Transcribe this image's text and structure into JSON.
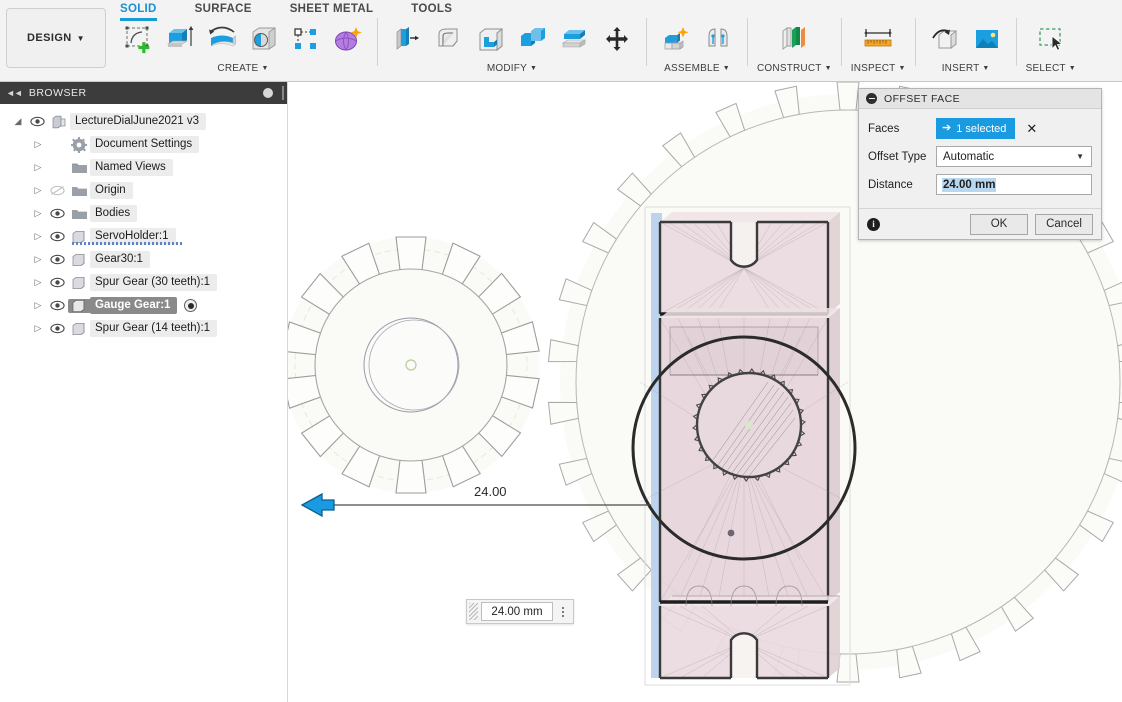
{
  "app": {
    "workspace_button": "DESIGN",
    "tabs": [
      {
        "label": "SOLID",
        "active": true
      },
      {
        "label": "SURFACE",
        "active": false
      },
      {
        "label": "SHEET METAL",
        "active": false
      },
      {
        "label": "TOOLS",
        "active": false
      }
    ],
    "groups": [
      {
        "name": "CREATE",
        "label": "CREATE",
        "icons": [
          "create-sketch-icon",
          "extrude-icon",
          "revolve-icon",
          "sweep-icon",
          "pattern-icon",
          "form-icon"
        ]
      },
      {
        "name": "MODIFY",
        "label": "MODIFY",
        "icons": [
          "press-pull-icon",
          "fillet-icon",
          "shell-icon",
          "combine-icon",
          "offset-face-icon",
          "move-copy-icon"
        ]
      },
      {
        "name": "ASSEMBLE",
        "label": "ASSEMBLE",
        "icons": [
          "new-component-icon",
          "joint-icon"
        ]
      },
      {
        "name": "CONSTRUCT",
        "label": "CONSTRUCT",
        "icons": [
          "offset-plane-icon"
        ]
      },
      {
        "name": "INSPECT",
        "label": "INSPECT",
        "icons": [
          "measure-icon"
        ]
      },
      {
        "name": "INSERT",
        "label": "INSERT",
        "icons": [
          "insert-derive-icon",
          "insert-canvas-icon"
        ]
      },
      {
        "name": "SELECT",
        "label": "SELECT",
        "icons": [
          "select-window-icon"
        ]
      }
    ]
  },
  "browser": {
    "title": "BROWSER",
    "items": [
      {
        "label": "LectureDialJune2021 v3",
        "depth": 0,
        "expanded": true,
        "eye": "visible",
        "icon": "document-icon",
        "selected": false,
        "radio": false,
        "dotted": false
      },
      {
        "label": "Document Settings",
        "depth": 1,
        "expanded": false,
        "eye": "none",
        "icon": "gear-icon",
        "selected": false,
        "radio": false,
        "dotted": false
      },
      {
        "label": "Named Views",
        "depth": 1,
        "expanded": false,
        "eye": "none",
        "icon": "folder-icon",
        "selected": false,
        "radio": false,
        "dotted": false
      },
      {
        "label": "Origin",
        "depth": 1,
        "expanded": false,
        "eye": "hidden",
        "icon": "folder-icon",
        "selected": false,
        "radio": false,
        "dotted": false
      },
      {
        "label": "Bodies",
        "depth": 1,
        "expanded": false,
        "eye": "visible",
        "icon": "folder-icon",
        "selected": false,
        "radio": false,
        "dotted": false
      },
      {
        "label": "ServoHolder:1",
        "depth": 1,
        "expanded": false,
        "eye": "visible",
        "icon": "component-icon",
        "selected": false,
        "radio": false,
        "dotted": true
      },
      {
        "label": "Gear30:1",
        "depth": 1,
        "expanded": false,
        "eye": "visible",
        "icon": "component-icon",
        "selected": false,
        "radio": false,
        "dotted": false
      },
      {
        "label": "Spur Gear (30 teeth):1",
        "depth": 1,
        "expanded": false,
        "eye": "visible",
        "icon": "component-icon",
        "selected": false,
        "radio": false,
        "dotted": false
      },
      {
        "label": "Gauge Gear:1",
        "depth": 1,
        "expanded": false,
        "eye": "visible",
        "icon": "component-icon",
        "selected": true,
        "radio": true,
        "dotted": false
      },
      {
        "label": "Spur Gear (14 teeth):1",
        "depth": 1,
        "expanded": false,
        "eye": "visible",
        "icon": "component-icon",
        "selected": false,
        "radio": false,
        "dotted": false
      }
    ]
  },
  "dialog": {
    "title": "OFFSET FACE",
    "faces_label": "Faces",
    "faces_value": "1 selected",
    "clear_selection": "✕",
    "offset_type_label": "Offset Type",
    "offset_type_value": "Automatic",
    "distance_label": "Distance",
    "distance_value": "24.00 mm",
    "ok_label": "OK",
    "cancel_label": "Cancel"
  },
  "canvas": {
    "dimension_text": "24.00",
    "value_box_value": "24.00 mm"
  },
  "colors": {
    "accent_blue": "#1a9ae0",
    "tab_active": "#169bd5",
    "selection_chip": "#1a9ae0",
    "body_translucent": "#e6d7dc",
    "highlight_face": "#bdd4ec",
    "tree_selected": "#8a8a8a",
    "dim_arrow": "#1a9ae0"
  }
}
